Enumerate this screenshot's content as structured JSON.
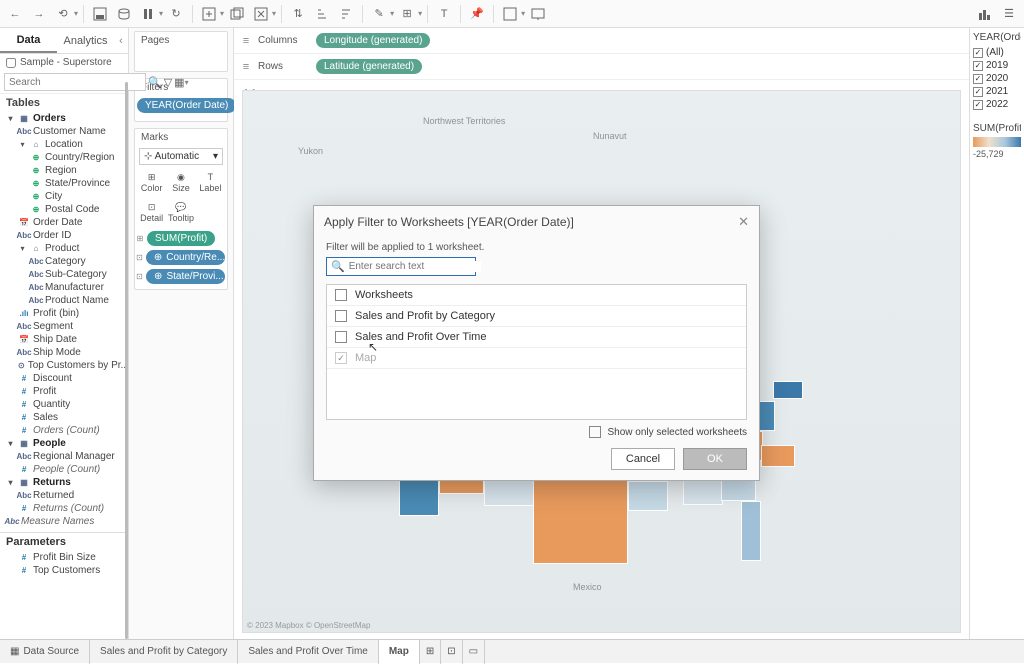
{
  "toolbar": {
    "items": []
  },
  "sidebar": {
    "tabs": {
      "data": "Data",
      "analytics": "Analytics"
    },
    "datasource": "Sample - Superstore",
    "search_placeholder": "Search",
    "tables_header": "Tables",
    "parameters_header": "Parameters",
    "tree": {
      "orders": "Orders",
      "customer_name": "Customer Name",
      "location": "Location",
      "country": "Country/Region",
      "region": "Region",
      "state": "State/Province",
      "city": "City",
      "postal": "Postal Code",
      "order_date": "Order Date",
      "order_id": "Order ID",
      "product": "Product",
      "category": "Category",
      "subcategory": "Sub-Category",
      "manufacturer": "Manufacturer",
      "product_name": "Product Name",
      "profit_bin": "Profit (bin)",
      "segment": "Segment",
      "ship_date": "Ship Date",
      "ship_mode": "Ship Mode",
      "top_customers": "Top Customers by Pr...",
      "discount": "Discount",
      "profit": "Profit",
      "quantity": "Quantity",
      "sales": "Sales",
      "orders_count": "Orders (Count)",
      "people": "People",
      "regional_manager": "Regional Manager",
      "people_count": "People (Count)",
      "returns": "Returns",
      "returned": "Returned",
      "returns_count": "Returns (Count)",
      "measure_names": "Measure Names",
      "profit_bin_size": "Profit Bin Size",
      "top_customers_param": "Top Customers"
    }
  },
  "shelf": {
    "pages": "Pages",
    "filters": "Filters",
    "marks": "Marks",
    "automatic": "Automatic",
    "cells": {
      "color": "Color",
      "size": "Size",
      "label": "Label",
      "detail": "Detail",
      "tooltip": "Tooltip"
    },
    "filter_pill": "YEAR(Order Date)",
    "mark_sum": "SUM(Profit)",
    "mark_country": "Country/Re...",
    "mark_state": "State/Provi..."
  },
  "shelves": {
    "columns_label": "Columns",
    "rows_label": "Rows",
    "columns_pill": "Longitude (generated)",
    "rows_pill": "Latitude (generated)"
  },
  "canvas": {
    "title": "Map",
    "credit": "© 2023 Mapbox © OpenStreetMap",
    "labels": {
      "nw": "Northwest Territories",
      "nunavut": "Nunavut",
      "yukon": "Yukon",
      "mexico": "Mexico"
    }
  },
  "legend": {
    "year_header": "YEAR(Order D",
    "items": [
      "(All)",
      "2019",
      "2020",
      "2021",
      "2022"
    ],
    "sum_header": "SUM(Profit)",
    "sum_min": "-25,729"
  },
  "dialog": {
    "title": "Apply Filter to Worksheets [YEAR(Order Date)]",
    "note": "Filter will be applied to 1 worksheet.",
    "search_placeholder": "Enter search text",
    "rows": [
      "Worksheets",
      "Sales and Profit by Category",
      "Sales and Profit Over Time",
      "Map"
    ],
    "show_only": "Show only selected worksheets",
    "cancel": "Cancel",
    "ok": "OK"
  },
  "bottom": {
    "datasource": "Data Source",
    "tab1": "Sales and Profit by Category",
    "tab2": "Sales and Profit Over Time",
    "tab3": "Map"
  }
}
